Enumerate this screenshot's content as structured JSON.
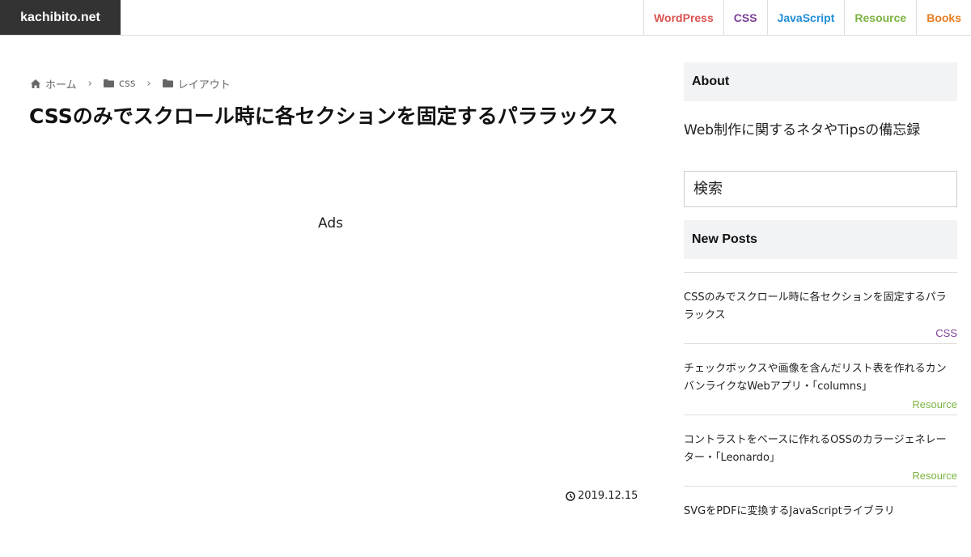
{
  "header": {
    "logo": "kachibito.net",
    "nav": [
      {
        "label": "WordPress",
        "color": "#d9534f"
      },
      {
        "label": "CSS",
        "color": "#7b3f98"
      },
      {
        "label": "JavaScript",
        "color": "#1f8dd6"
      },
      {
        "label": "Resource",
        "color": "#7cb342"
      },
      {
        "label": "Books",
        "color": "#e67e22"
      }
    ]
  },
  "breadcrumb": {
    "items": [
      {
        "label": "ホーム",
        "icon": "home-icon"
      },
      {
        "label": "css",
        "icon": "folder-icon"
      },
      {
        "label": "レイアウト",
        "icon": "folder-icon"
      }
    ],
    "separator": "›"
  },
  "article": {
    "title": "CSSのみでスクロール時に各セクションを固定するパララックス",
    "ads": "Ads",
    "date": "2019.12.15",
    "date_icon": "clock-icon"
  },
  "sidebar": {
    "about": {
      "heading": "About",
      "text": "Web制作に関するネタやTipsの備忘録"
    },
    "search": {
      "placeholder": "検索"
    },
    "new_posts": {
      "heading": "New Posts",
      "items": [
        {
          "title": "CSSのみでスクロール時に各セクションを固定するパララックス",
          "category": "CSS"
        },
        {
          "title": "チェックボックスや画像を含んだリスト表を作れるカンバンライクなWebアプリ・「columns」",
          "category": "Resource"
        },
        {
          "title": "コントラストをベースに作れるOSSのカラージェネレーター・「Leonardo」",
          "category": "Resource"
        },
        {
          "title": "SVGをPDFに変換するJavaScriptライブラリ",
          "category": ""
        }
      ]
    }
  }
}
